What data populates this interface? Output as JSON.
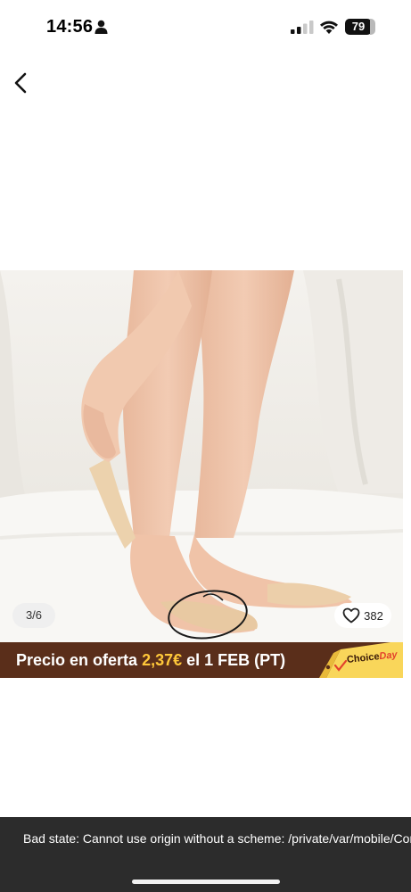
{
  "status_bar": {
    "time": "14:56",
    "battery_level": "79"
  },
  "product": {
    "image_counter": "3/6",
    "likes_count": "382",
    "heart_icon": "heart-outline-icon"
  },
  "sale_banner": {
    "prefix": "Precio en oferta",
    "price": "2,37€",
    "suffix": "el 1 FEB (PT)",
    "badge_choice": "Choice",
    "badge_day": "Day",
    "background": "#5a2e1a",
    "price_color": "#ffc83a"
  },
  "error_toast": {
    "message": "Bad state: Cannot use origin without a scheme: /private/var/mobile/Containers/Data/Application"
  }
}
